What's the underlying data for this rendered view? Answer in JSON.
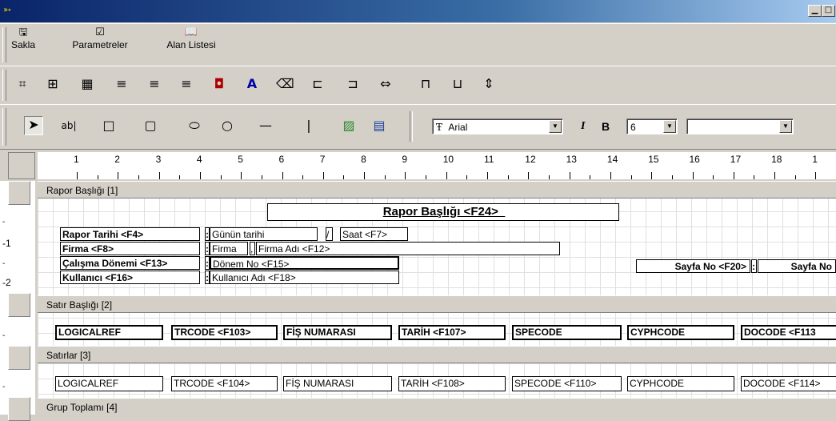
{
  "toolbar": {
    "save": "Sakla",
    "params": "Parametreler",
    "fields": "Alan Listesi"
  },
  "font": {
    "name": "Arial",
    "size": "6",
    "bold": "B",
    "italic": "I"
  },
  "ruler": [
    "1",
    "2",
    "3",
    "4",
    "5",
    "6",
    "7",
    "8",
    "9",
    "10",
    "11",
    "12",
    "13",
    "14",
    "15",
    "16",
    "17",
    "18",
    "1"
  ],
  "leftruler": [
    "-1",
    "-2"
  ],
  "bands": {
    "report_header": "Rapor Başlığı [1]",
    "row_header": "Satır Başlığı [2]",
    "rows": "Satırlar [3]",
    "group_total": "Grup Toplamı [4]"
  },
  "report": {
    "title": "Rapor Başlığı <F24>_",
    "date_label": "Rapor Tarihi <F4>",
    "firm_label": "Firma <F8>",
    "period_label": "Çalışma Dönemi <F13>",
    "user_label": "Kullanıcı <F16>",
    "colon": ":",
    "today": "Günün tarihi",
    "slash": "/",
    "time": "Saat <F7>",
    "firm": "Firma",
    "comma": ",",
    "firm_name": "Firma Adı <F12>",
    "period_no": "Dönem No <F15>",
    "user_name": "Kullanıcı Adı <F18>",
    "page_label": "Sayfa No <F20>",
    "page_value": "Sayfa No"
  },
  "columns_header": [
    "LOGICALREF",
    "TRCODE <F103>",
    "FİŞ NUMARASI",
    "TARİH <F107>",
    "SPECODE",
    "CYPHCODE",
    "DOCODE <F113"
  ],
  "columns_rows": [
    "LOGICALREF",
    "TRCODE <F104>",
    "FİŞ NUMARASI",
    "TARİH <F108>",
    "SPECODE <F110>",
    "CYPHCODE",
    "DOCODE <F114>"
  ]
}
